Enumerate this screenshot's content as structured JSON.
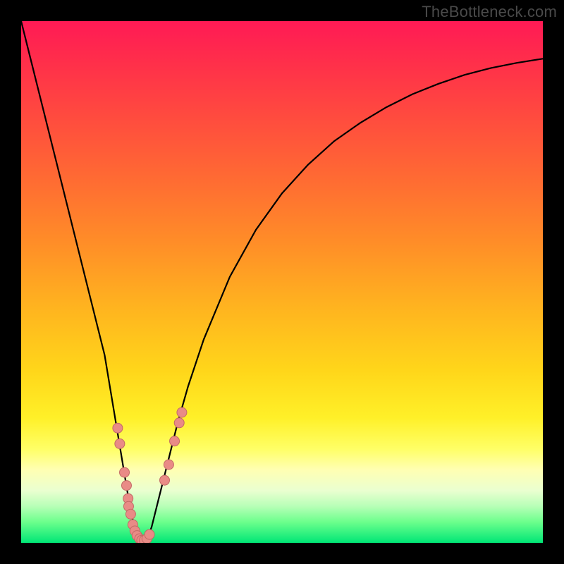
{
  "watermark": "TheBottleneck.com",
  "colors": {
    "frame": "#000000",
    "curve": "#000000",
    "dot_fill": "#e98b86",
    "dot_stroke": "#c36a66"
  },
  "chart_data": {
    "type": "line",
    "title": "",
    "xlabel": "",
    "ylabel": "",
    "xlim": [
      0,
      100
    ],
    "ylim": [
      0,
      100
    ],
    "series": [
      {
        "name": "curve",
        "x": [
          0,
          2,
          4,
          6,
          8,
          10,
          12,
          14,
          16,
          18,
          19,
          20,
          21,
          22,
          23,
          24,
          25,
          26,
          27,
          28,
          30,
          32,
          35,
          40,
          45,
          50,
          55,
          60,
          65,
          70,
          75,
          80,
          85,
          90,
          95,
          100
        ],
        "values": [
          100,
          92,
          84,
          76,
          68,
          60,
          52,
          44,
          36,
          24,
          18,
          12,
          6,
          2,
          0.5,
          0.5,
          3,
          7,
          11,
          15,
          23,
          30,
          39,
          51,
          60,
          67,
          72.5,
          77,
          80.5,
          83.5,
          86,
          88,
          89.7,
          91,
          92,
          92.8
        ]
      }
    ],
    "scatter": [
      {
        "name": "left-dots",
        "points": [
          {
            "x": 18.5,
            "y": 22
          },
          {
            "x": 18.9,
            "y": 19
          },
          {
            "x": 19.8,
            "y": 13.5
          },
          {
            "x": 20.2,
            "y": 11
          },
          {
            "x": 20.5,
            "y": 8.5
          },
          {
            "x": 20.6,
            "y": 7
          },
          {
            "x": 21.0,
            "y": 5.5
          },
          {
            "x": 21.4,
            "y": 3.5
          },
          {
            "x": 21.8,
            "y": 2.3
          },
          {
            "x": 22.2,
            "y": 1.4
          },
          {
            "x": 22.7,
            "y": 0.8
          },
          {
            "x": 23.1,
            "y": 0.5
          },
          {
            "x": 23.6,
            "y": 0.5
          },
          {
            "x": 24.1,
            "y": 0.8
          },
          {
            "x": 24.6,
            "y": 1.6
          }
        ]
      },
      {
        "name": "right-dots",
        "points": [
          {
            "x": 27.5,
            "y": 12
          },
          {
            "x": 28.3,
            "y": 15
          },
          {
            "x": 29.4,
            "y": 19.5
          },
          {
            "x": 30.3,
            "y": 23
          },
          {
            "x": 30.8,
            "y": 25
          }
        ]
      }
    ]
  }
}
